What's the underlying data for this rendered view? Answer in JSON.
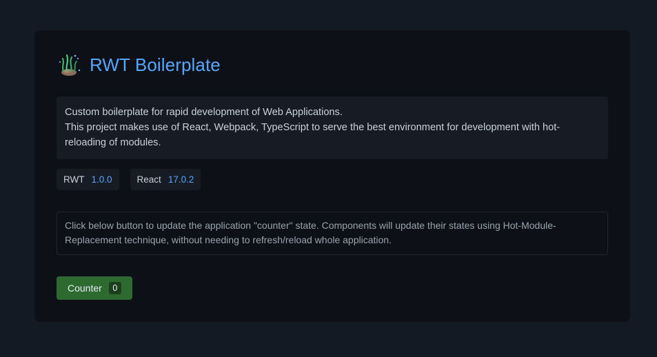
{
  "header": {
    "logo_icon": "seaweed-rock-icon",
    "title": "RWT Boilerplate"
  },
  "description": {
    "line1": "Custom boilerplate for rapid development of Web Applications.",
    "line2": "This project makes use of React, Webpack, TypeScript to serve the best environment for development with hot-reloading of modules."
  },
  "badges": [
    {
      "name": "RWT",
      "version": "1.0.0"
    },
    {
      "name": "React",
      "version": "17.0.2"
    }
  ],
  "info": {
    "text": "Click below button to update the application \"counter\" state. Components will update their states using Hot-Module-Replacement technique, without needing to refresh/reload whole application."
  },
  "counter": {
    "label": "Counter",
    "value": "0"
  },
  "colors": {
    "background": "#141a24",
    "card": "#0d1017",
    "accent": "#58a6ff",
    "button": "#2d6a2f"
  }
}
